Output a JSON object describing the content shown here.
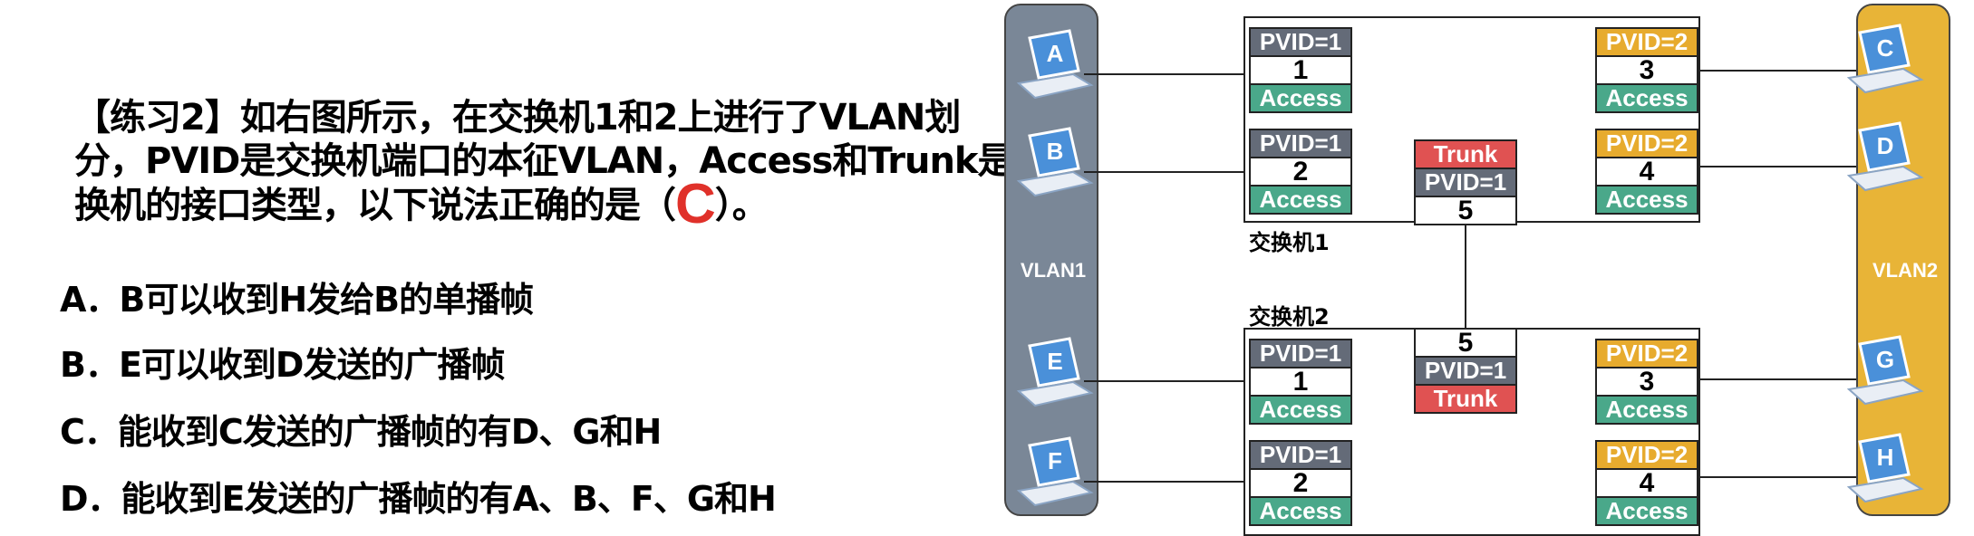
{
  "question": {
    "lines": [
      "【练习2】如右图所示，在交换机1和2上进行了VLAN划",
      "分，PVID是交换机端口的本征VLAN，Access和Trunk是交",
      "换机的接口类型，以下说法正确的是（"
    ],
    "answer": "C",
    "close": "）。"
  },
  "options": [
    {
      "label": "A．B可以收到H发给B的单播帧"
    },
    {
      "label": "B．E可以收到D发送的广播帧"
    },
    {
      "label": "C．能收到C发送的广播帧的有D、G和H"
    },
    {
      "label": "D．能收到E发送的广播帧的有A、B、F、G和H"
    }
  ],
  "diagram": {
    "vlan1": {
      "label": "VLAN1",
      "color": "#7a8797"
    },
    "vlan2": {
      "label": "VLAN2",
      "color": "#e8b437"
    },
    "switch1_label": "交换机1",
    "switch2_label": "交换机2",
    "hosts": {
      "A": "A",
      "B": "B",
      "C": "C",
      "D": "D",
      "E": "E",
      "F": "F",
      "G": "G",
      "H": "H"
    },
    "ports": {
      "s1p1": {
        "pvid": "PVID=1",
        "num": "1",
        "mode": "Access"
      },
      "s1p2": {
        "pvid": "PVID=1",
        "num": "2",
        "mode": "Access"
      },
      "s1p3": {
        "pvid": "PVID=2",
        "num": "3",
        "mode": "Access"
      },
      "s1p4": {
        "pvid": "PVID=2",
        "num": "4",
        "mode": "Access"
      },
      "s1p5": {
        "pvid": "PVID=1",
        "num": "5",
        "mode": "Trunk"
      },
      "s2p1": {
        "pvid": "PVID=1",
        "num": "1",
        "mode": "Access"
      },
      "s2p2": {
        "pvid": "PVID=1",
        "num": "2",
        "mode": "Access"
      },
      "s2p3": {
        "pvid": "PVID=2",
        "num": "3",
        "mode": "Access"
      },
      "s2p4": {
        "pvid": "PVID=2",
        "num": "4",
        "mode": "Access"
      },
      "s2p5": {
        "pvid": "PVID=1",
        "num": "5",
        "mode": "Trunk"
      }
    },
    "colors": {
      "pvid1": "#646b78",
      "pvid2": "#e7ab2e",
      "access": "#4aa88a",
      "trunk": "#e05252",
      "laptop": "#4a90d9"
    }
  }
}
